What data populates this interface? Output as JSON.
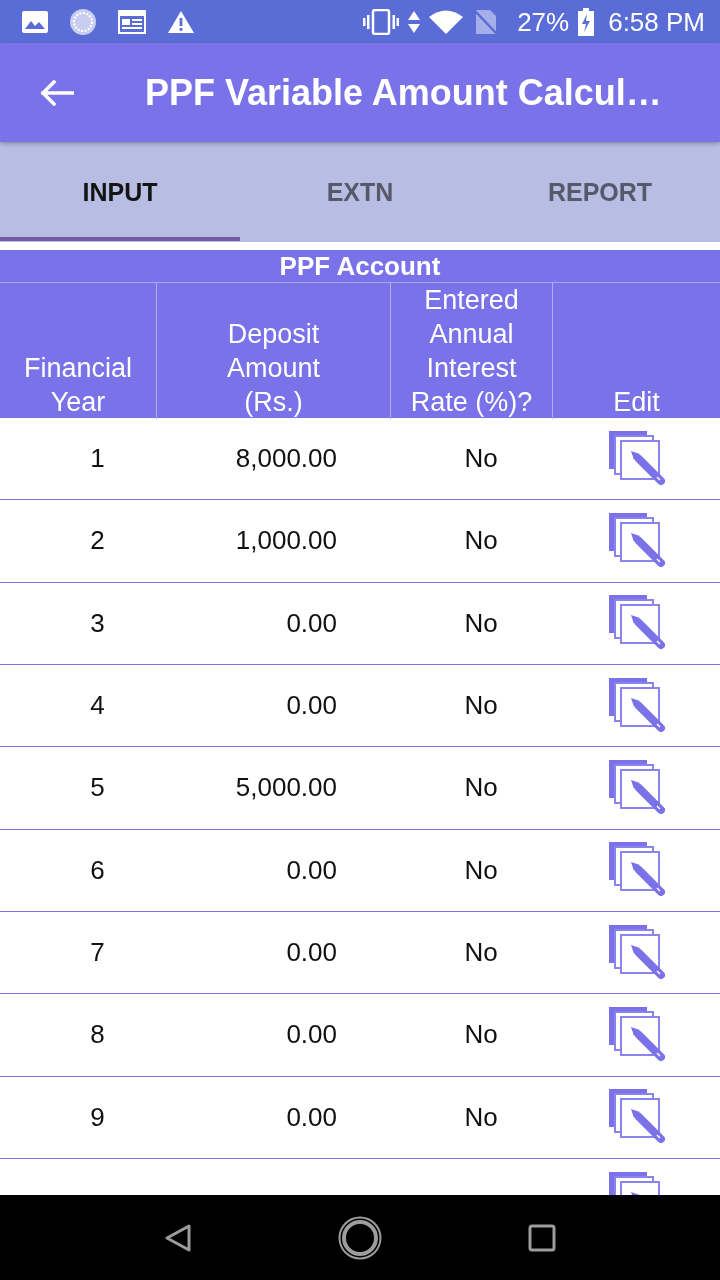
{
  "status_bar": {
    "battery": "27%",
    "time": "6:58 PM"
  },
  "app_bar": {
    "title": "PPF Variable Amount Calcul…"
  },
  "tabs": [
    {
      "label": "INPUT",
      "selected": true
    },
    {
      "label": "EXTN",
      "selected": false
    },
    {
      "label": "REPORT",
      "selected": false
    }
  ],
  "table": {
    "title": "PPF Account",
    "columns": [
      "Financial Year",
      "Deposit Amount (Rs.)",
      "Entered Annual Interest Rate (%)?",
      "Edit"
    ],
    "rows": [
      {
        "year": "1",
        "deposit": "8,000.00",
        "rate_entered": "No"
      },
      {
        "year": "2",
        "deposit": "1,000.00",
        "rate_entered": "No"
      },
      {
        "year": "3",
        "deposit": "0.00",
        "rate_entered": "No"
      },
      {
        "year": "4",
        "deposit": "0.00",
        "rate_entered": "No"
      },
      {
        "year": "5",
        "deposit": "5,000.00",
        "rate_entered": "No"
      },
      {
        "year": "6",
        "deposit": "0.00",
        "rate_entered": "No"
      },
      {
        "year": "7",
        "deposit": "0.00",
        "rate_entered": "No"
      },
      {
        "year": "8",
        "deposit": "0.00",
        "rate_entered": "No"
      },
      {
        "year": "9",
        "deposit": "0.00",
        "rate_entered": "No"
      },
      {}
    ]
  }
}
